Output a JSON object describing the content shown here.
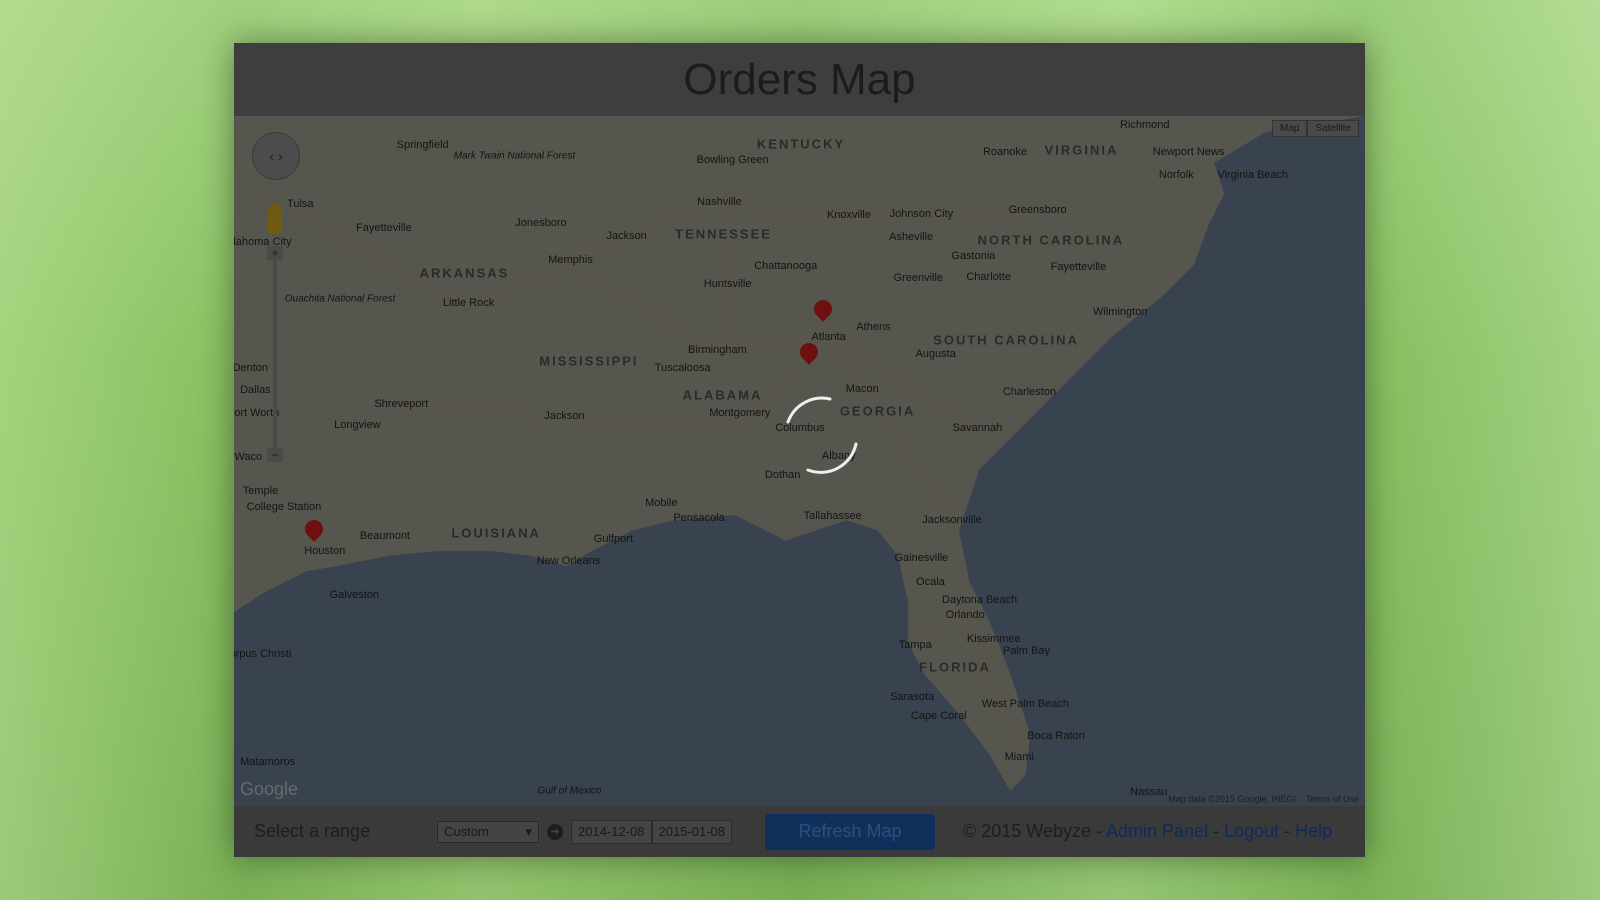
{
  "title": "Orders Map",
  "map": {
    "type_buttons": [
      "Map",
      "Satellite"
    ],
    "attribution": "Map data ©2015 Google, INEGI",
    "terms": "Terms of Use",
    "logo": "Google",
    "zoom_in": "+",
    "zoom_out": "−",
    "colors": {
      "land": "#56554e",
      "water": "#39424f",
      "marker": "#6e1010"
    },
    "labels": [
      "Springfield",
      "Mark Twain National Forest",
      "Bowling Green",
      "KENTUCKY",
      "Richmond",
      "VIRGINIA",
      "Roanoke",
      "Newport News",
      "Norfolk",
      "Virginia Beach",
      "Tulsa",
      "Fayetteville",
      "Jonesboro",
      "Nashville",
      "Knoxville",
      "Johnson City",
      "Greensboro",
      "TENNESSEE",
      "Jackson",
      "Asheville",
      "NORTH CAROLINA",
      "ARKANSAS",
      "Memphis",
      "Chattanooga",
      "Greenville",
      "Charlotte",
      "Fayetteville",
      "Ouachita National Forest",
      "Little Rock",
      "Huntsville",
      "Gastonia",
      "Wilmington",
      "Athens",
      "Atlanta",
      "SOUTH CAROLINA",
      "MISSISSIPPI",
      "Birmingham",
      "Tuscaloosa",
      "Augusta",
      "ALABAMA",
      "Macon",
      "Charleston",
      "Shreveport",
      "Jackson",
      "Montgomery",
      "GEORGIA",
      "Columbus",
      "Savannah",
      "Longview",
      "Albany",
      "Dothan",
      "Mobile",
      "Pensacola",
      "Tallahassee",
      "Jacksonville",
      "LOUISIANA",
      "Beaumont",
      "Houston",
      "Gulfport",
      "New Orleans",
      "Galveston",
      "Gainesville",
      "Ocala",
      "Daytona Beach",
      "Orlando",
      "Tampa",
      "Kissimmee",
      "Palm Bay",
      "FLORIDA",
      "Sarasota",
      "West Palm Beach",
      "Cape Coral",
      "Boca Raton",
      "Miami",
      "Dallas",
      "Fort Worth",
      "Waco",
      "Temple",
      "College Station",
      "Matamoros",
      "Corpus Christi",
      "Gulf of Mexico",
      "Nassau",
      "Denton",
      "Oklahoma City"
    ]
  },
  "footer": {
    "range_label": "Select a range",
    "range_value": "Custom",
    "date_from": "2014-12-08",
    "date_to": "2015-01-08",
    "refresh": "Refresh Map",
    "copyright": "© 2015 Webyze - ",
    "admin": "Admin Panel",
    "sep": " - ",
    "logout": "Logout",
    "help": "Help"
  }
}
